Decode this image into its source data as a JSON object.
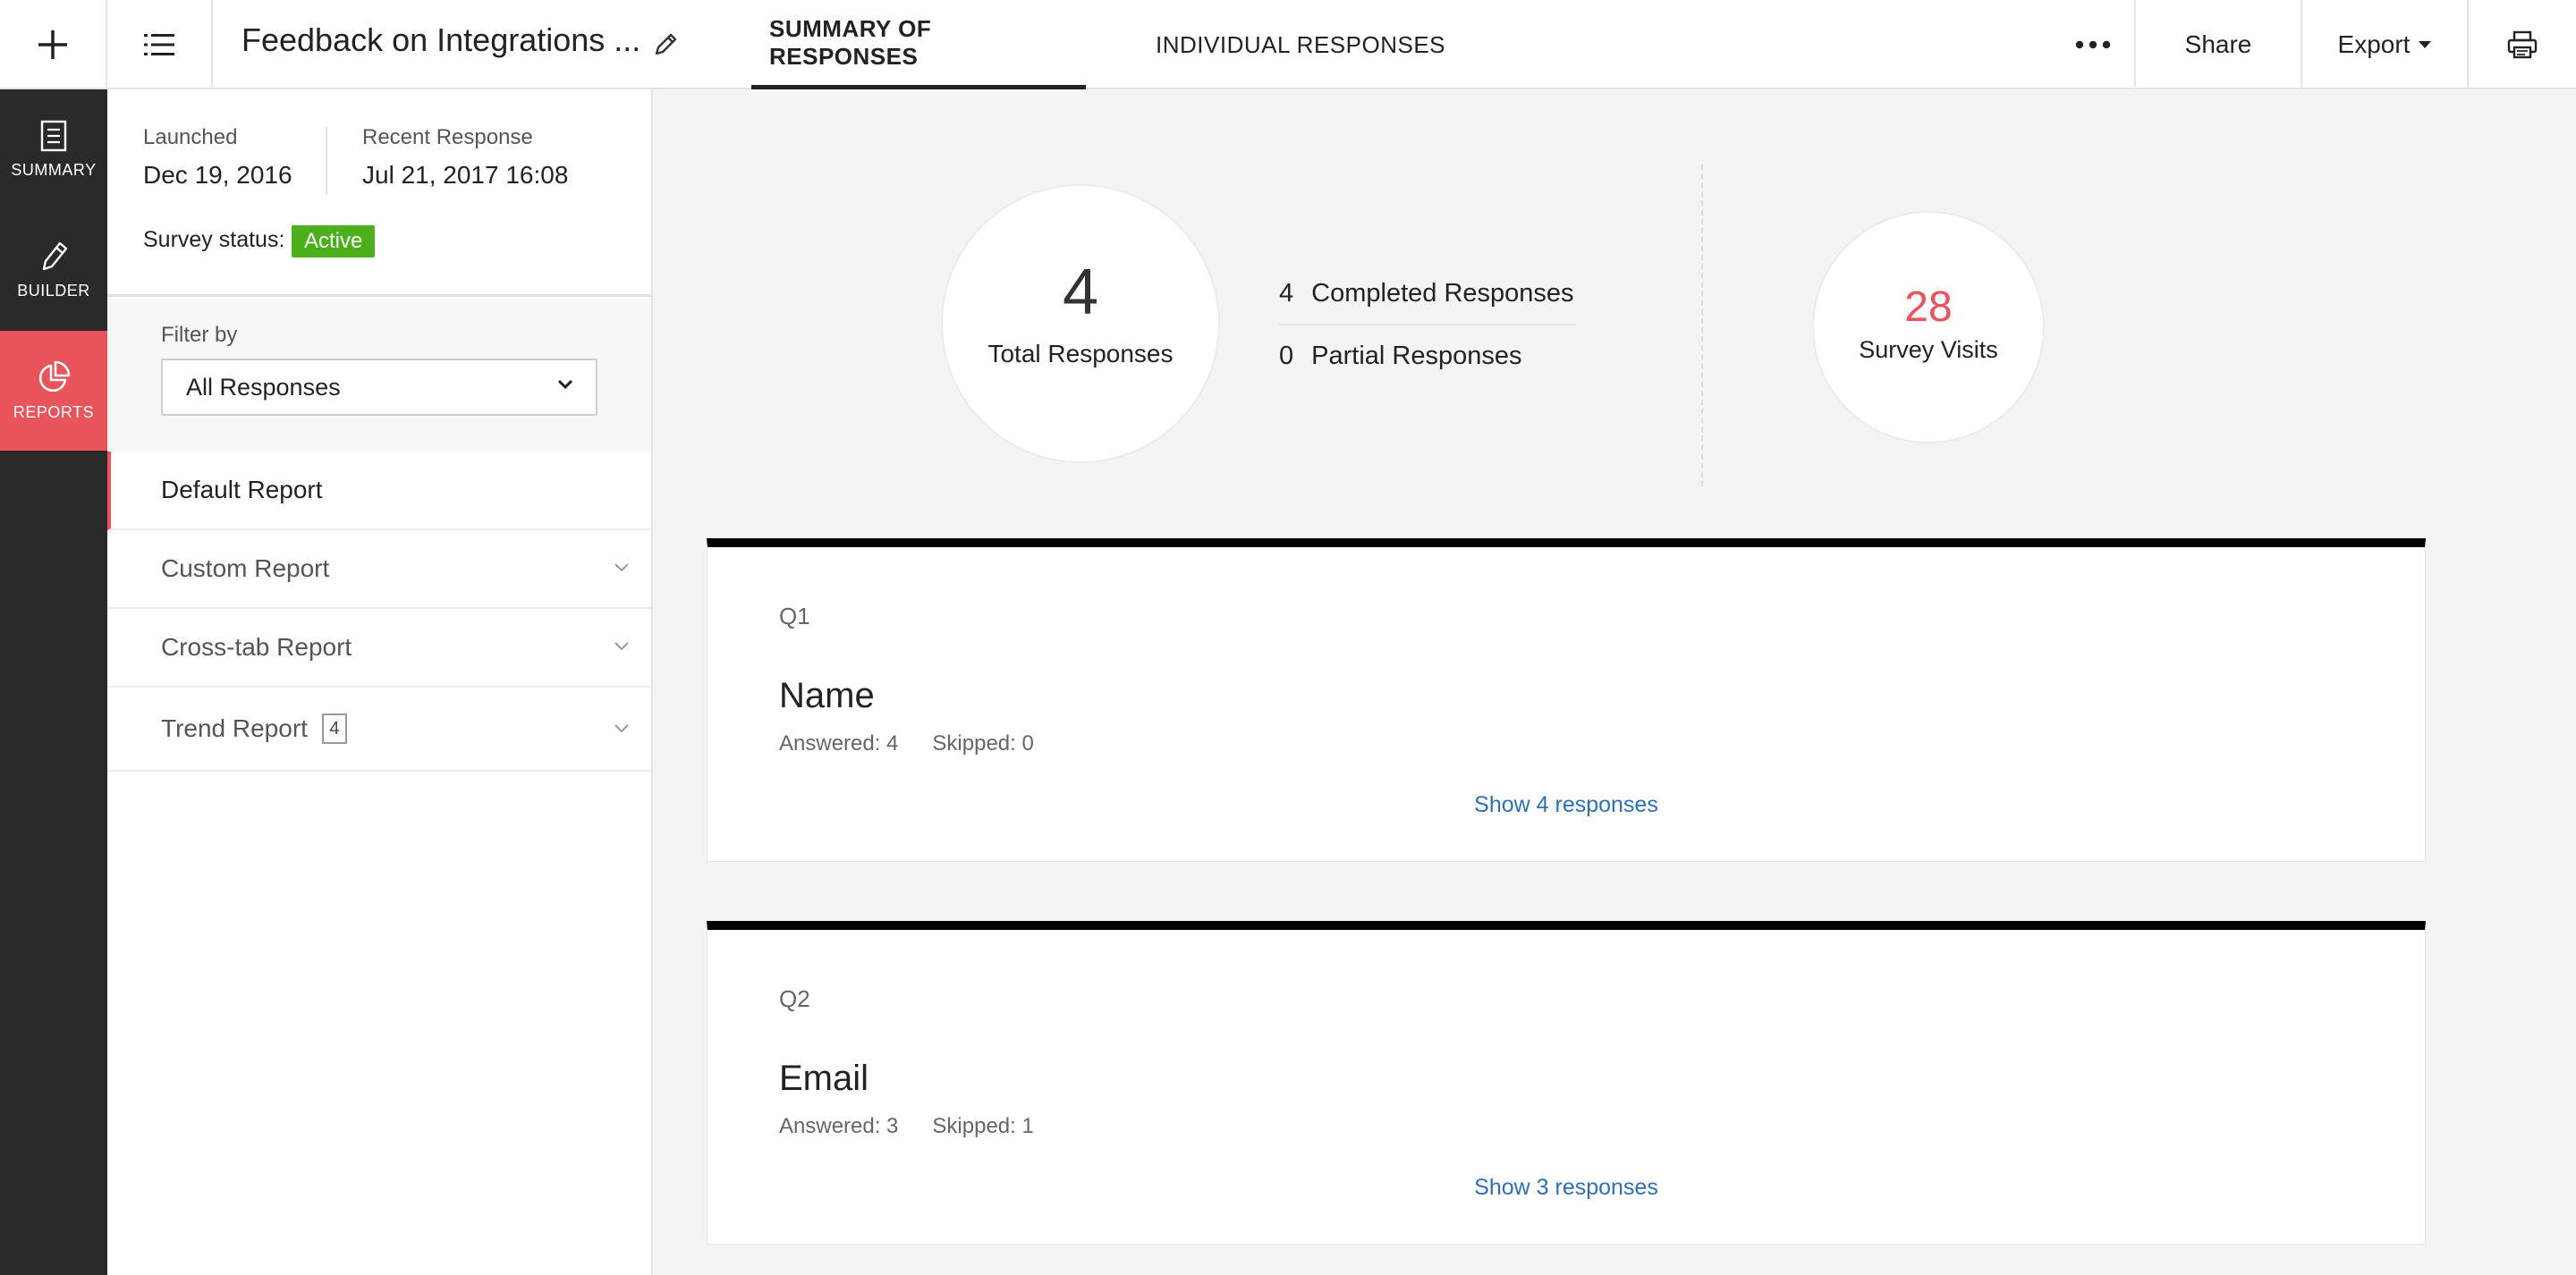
{
  "header": {
    "survey_title": "Feedback on Integrations ...",
    "tabs": [
      {
        "label": "SUMMARY OF RESPONSES",
        "active": true
      },
      {
        "label": "INDIVIDUAL RESPONSES",
        "active": false
      }
    ],
    "share_label": "Share",
    "export_label": "Export",
    "icons": {
      "add": "plus-icon",
      "list": "list-icon",
      "edit": "pencil-icon",
      "more": "more-dots-icon",
      "dropdown": "caret-down-icon",
      "print": "printer-icon"
    }
  },
  "rail": {
    "items": [
      {
        "label": "SUMMARY",
        "icon": "document-icon",
        "active": false
      },
      {
        "label": "BUILDER",
        "icon": "pencil-icon",
        "active": false
      },
      {
        "label": "REPORTS",
        "icon": "pie-chart-icon",
        "active": true
      }
    ],
    "accent_color": "#e9535a"
  },
  "panel": {
    "launched_label": "Launched",
    "launched_value": "Dec 19, 2016",
    "recent_label": "Recent Response",
    "recent_value": "Jul 21, 2017 16:08",
    "status_label": "Survey status:",
    "status_value": "Active",
    "status_color": "#4caf1c",
    "filter_label": "Filter by",
    "filter_value": "All Responses",
    "reports": [
      {
        "label": "Default Report",
        "active": true,
        "count": null
      },
      {
        "label": "Custom Report",
        "active": false,
        "count": null
      },
      {
        "label": "Cross-tab Report",
        "active": false,
        "count": null
      },
      {
        "label": "Trend Report",
        "active": false,
        "count": "4"
      }
    ]
  },
  "summary": {
    "total_value": "4",
    "total_label": "Total Responses",
    "completed_value": "4",
    "completed_label": "Completed Responses",
    "partial_value": "0",
    "partial_label": "Partial Responses",
    "visits_value": "28",
    "visits_label": "Survey Visits"
  },
  "questions": [
    {
      "number": "Q1",
      "title": "Name",
      "answered": "Answered: 4",
      "skipped": "Skipped: 0",
      "link": "Show 4 responses"
    },
    {
      "number": "Q2",
      "title": "Email",
      "answered": "Answered: 3",
      "skipped": "Skipped: 1",
      "link": "Show 3 responses"
    }
  ]
}
